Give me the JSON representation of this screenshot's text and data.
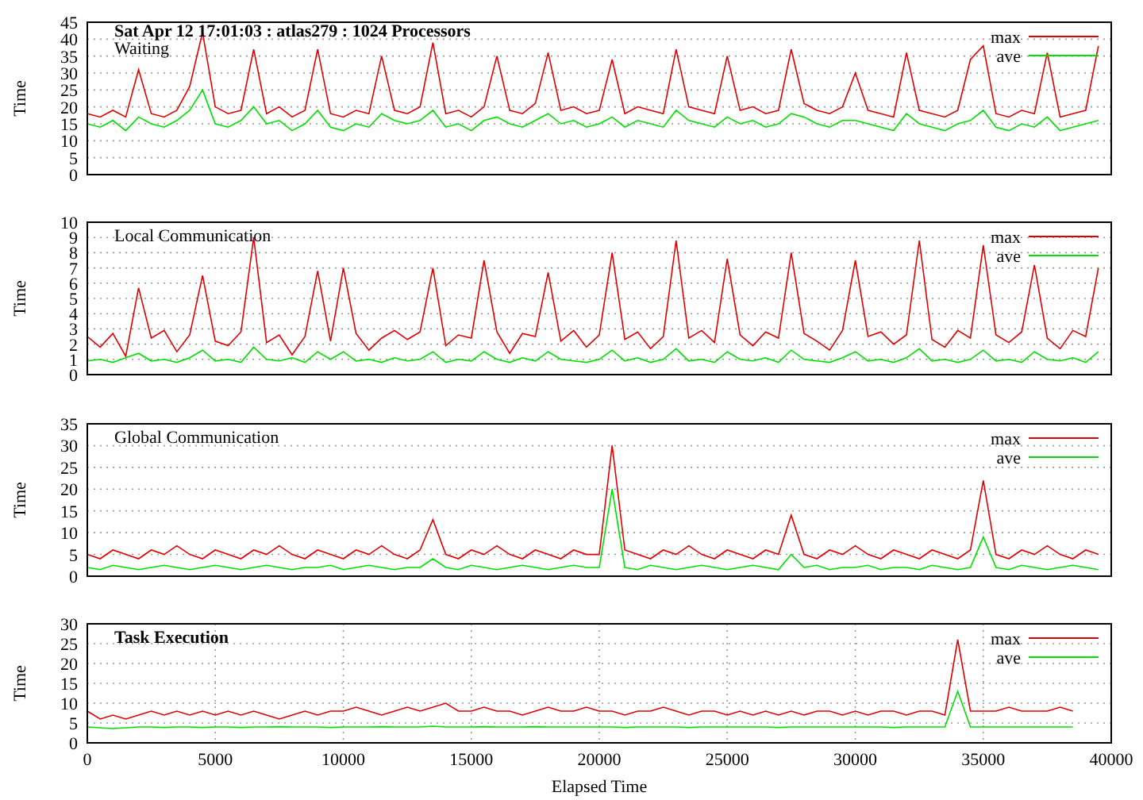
{
  "header": "Sat Apr 12 17:01:03 : atlas279 : 1024 Processors",
  "charts": [
    {
      "chart_data": {
        "type": "line",
        "title": "Waiting",
        "ylabel": "Time",
        "xlim": [
          0,
          40000
        ],
        "ylim": [
          0,
          45
        ],
        "yticks": [
          0,
          5,
          10,
          15,
          20,
          25,
          30,
          35,
          40,
          45
        ],
        "grid": "y",
        "legend": "top right",
        "x": [
          0,
          500,
          1000,
          1500,
          2000,
          2500,
          3000,
          3500,
          4000,
          4500,
          5000,
          5500,
          6000,
          6500,
          7000,
          7500,
          8000,
          8500,
          9000,
          9500,
          10000,
          10500,
          11000,
          11500,
          12000,
          12500,
          13000,
          13500,
          14000,
          14500,
          15000,
          15500,
          16000,
          16500,
          17000,
          17500,
          18000,
          18500,
          19000,
          19500,
          20000,
          20500,
          21000,
          21500,
          22000,
          22500,
          23000,
          23500,
          24000,
          24500,
          25000,
          25500,
          26000,
          26500,
          27000,
          27500,
          28000,
          28500,
          29000,
          29500,
          30000,
          30500,
          31000,
          31500,
          32000,
          32500,
          33000,
          33500,
          34000,
          34500,
          35000,
          35500,
          36000,
          36500,
          37000,
          37500,
          38000,
          38500,
          39000,
          39500
        ],
        "series": [
          {
            "name": "max",
            "color": "#e00000",
            "values": [
              18,
              17,
              19,
              17,
              31,
              18,
              17,
              19,
              26,
              42,
              20,
              18,
              19,
              37,
              18,
              20,
              17,
              19,
              37,
              18,
              17,
              19,
              18,
              35,
              19,
              18,
              20,
              39,
              18,
              19,
              17,
              20,
              35,
              19,
              18,
              21,
              36,
              19,
              20,
              18,
              19,
              34,
              18,
              20,
              19,
              18,
              37,
              20,
              19,
              18,
              35,
              19,
              20,
              18,
              19,
              37,
              21,
              19,
              18,
              20,
              30,
              19,
              18,
              17,
              36,
              19,
              18,
              17,
              19,
              34,
              38,
              18,
              17,
              19,
              18,
              36,
              17,
              18,
              19,
              38
            ]
          },
          {
            "name": "ave",
            "color": "#00e000",
            "values": [
              15,
              14,
              16,
              13,
              17,
              15,
              14,
              16,
              19,
              25,
              15,
              14,
              16,
              20,
              15,
              16,
              13,
              15,
              19,
              14,
              13,
              15,
              14,
              18,
              16,
              15,
              16,
              19,
              14,
              15,
              13,
              16,
              17,
              15,
              14,
              16,
              18,
              15,
              16,
              14,
              15,
              17,
              14,
              16,
              15,
              14,
              19,
              16,
              15,
              14,
              17,
              15,
              16,
              14,
              15,
              18,
              17,
              15,
              14,
              16,
              16,
              15,
              14,
              13,
              18,
              15,
              14,
              13,
              15,
              16,
              19,
              14,
              13,
              15,
              14,
              17,
              13,
              14,
              15,
              16
            ]
          }
        ]
      }
    },
    {
      "chart_data": {
        "type": "line",
        "title": "Local Communication",
        "ylabel": "Time",
        "xlim": [
          0,
          40000
        ],
        "ylim": [
          0,
          10
        ],
        "yticks": [
          0,
          1,
          2,
          3,
          4,
          5,
          6,
          7,
          8,
          9,
          10
        ],
        "grid": "y",
        "legend": "top right",
        "x": [
          0,
          500,
          1000,
          1500,
          2000,
          2500,
          3000,
          3500,
          4000,
          4500,
          5000,
          5500,
          6000,
          6500,
          7000,
          7500,
          8000,
          8500,
          9000,
          9500,
          10000,
          10500,
          11000,
          11500,
          12000,
          12500,
          13000,
          13500,
          14000,
          14500,
          15000,
          15500,
          16000,
          16500,
          17000,
          17500,
          18000,
          18500,
          19000,
          19500,
          20000,
          20500,
          21000,
          21500,
          22000,
          22500,
          23000,
          23500,
          24000,
          24500,
          25000,
          25500,
          26000,
          26500,
          27000,
          27500,
          28000,
          28500,
          29000,
          29500,
          30000,
          30500,
          31000,
          31500,
          32000,
          32500,
          33000,
          33500,
          34000,
          34500,
          35000,
          35500,
          36000,
          36500,
          37000,
          37500,
          38000,
          38500,
          39000,
          39500
        ],
        "series": [
          {
            "name": "max",
            "color": "#e00000",
            "values": [
              2.5,
              1.8,
              2.7,
              1.2,
              5.7,
              2.4,
              2.9,
              1.5,
              2.6,
              6.5,
              2.2,
              1.9,
              2.8,
              9,
              2.1,
              2.6,
              1.3,
              2.5,
              6.8,
              2.2,
              7,
              2.7,
              1.6,
              2.4,
              2.9,
              2.3,
              2.8,
              7,
              1.9,
              2.6,
              2.4,
              7.5,
              2.8,
              1.4,
              2.7,
              2.5,
              6.7,
              2.2,
              2.9,
              1.8,
              2.6,
              8,
              2.3,
              2.8,
              1.7,
              2.5,
              8.8,
              2.4,
              2.9,
              2.1,
              7.6,
              2.6,
              1.9,
              2.8,
              2.4,
              8,
              2.7,
              2.2,
              1.6,
              2.9,
              7.5,
              2.5,
              2.8,
              2,
              2.6,
              8.8,
              2.3,
              1.8,
              2.9,
              2.4,
              8.5,
              2.6,
              2.1,
              2.8,
              7.2,
              2.4,
              1.7,
              2.9,
              2.5,
              7
            ]
          },
          {
            "name": "ave",
            "color": "#00e000",
            "values": [
              0.9,
              1,
              0.8,
              1.1,
              1.4,
              0.9,
              1,
              0.8,
              1.1,
              1.6,
              0.9,
              1,
              0.8,
              1.8,
              1,
              0.9,
              1.1,
              0.8,
              1.5,
              1,
              1.5,
              0.9,
              1,
              0.8,
              1.1,
              0.9,
              1,
              1.5,
              0.8,
              1,
              0.9,
              1.5,
              1,
              0.8,
              1.1,
              0.9,
              1.5,
              1,
              0.9,
              0.8,
              1,
              1.6,
              0.9,
              1.1,
              0.8,
              1,
              1.7,
              0.9,
              1,
              0.8,
              1.5,
              1,
              0.9,
              1.1,
              0.8,
              1.6,
              1,
              0.9,
              0.8,
              1.1,
              1.5,
              0.9,
              1,
              0.8,
              1.1,
              1.7,
              0.9,
              1,
              0.8,
              1,
              1.6,
              0.9,
              1,
              0.8,
              1.5,
              1,
              0.9,
              1.1,
              0.8,
              1.5
            ]
          }
        ]
      }
    },
    {
      "chart_data": {
        "type": "line",
        "title": "Global Communication",
        "ylabel": "Time",
        "xlim": [
          0,
          40000
        ],
        "ylim": [
          0,
          35
        ],
        "yticks": [
          0,
          5,
          10,
          15,
          20,
          25,
          30,
          35
        ],
        "grid": "y",
        "legend": "top right",
        "x": [
          0,
          500,
          1000,
          1500,
          2000,
          2500,
          3000,
          3500,
          4000,
          4500,
          5000,
          5500,
          6000,
          6500,
          7000,
          7500,
          8000,
          8500,
          9000,
          9500,
          10000,
          10500,
          11000,
          11500,
          12000,
          12500,
          13000,
          13500,
          14000,
          14500,
          15000,
          15500,
          16000,
          16500,
          17000,
          17500,
          18000,
          18500,
          19000,
          19500,
          20000,
          20500,
          21000,
          21500,
          22000,
          22500,
          23000,
          23500,
          24000,
          24500,
          25000,
          25500,
          26000,
          26500,
          27000,
          27500,
          28000,
          28500,
          29000,
          29500,
          30000,
          30500,
          31000,
          31500,
          32000,
          32500,
          33000,
          33500,
          34000,
          34500,
          35000,
          35500,
          36000,
          36500,
          37000,
          37500,
          38000,
          38500,
          39000,
          39500
        ],
        "series": [
          {
            "name": "max",
            "color": "#e00000",
            "values": [
              5,
              4,
              6,
              5,
              4,
              6,
              5,
              7,
              5,
              4,
              6,
              5,
              4,
              6,
              5,
              7,
              5,
              4,
              6,
              5,
              4,
              6,
              5,
              7,
              5,
              4,
              6,
              13,
              5,
              4,
              6,
              5,
              7,
              5,
              4,
              6,
              5,
              4,
              6,
              5,
              5,
              30,
              6,
              5,
              4,
              6,
              5,
              7,
              5,
              4,
              6,
              5,
              4,
              6,
              5,
              14,
              5,
              4,
              6,
              5,
              7,
              5,
              4,
              6,
              5,
              4,
              6,
              5,
              4,
              6,
              22,
              5,
              4,
              6,
              5,
              7,
              5,
              4,
              6,
              5
            ]
          },
          {
            "name": "ave",
            "color": "#00e000",
            "values": [
              2,
              1.5,
              2.5,
              2,
              1.5,
              2,
              2.5,
              2,
              1.5,
              2,
              2.5,
              2,
              1.5,
              2,
              2.5,
              2,
              1.5,
              2,
              2,
              2.5,
              1.5,
              2,
              2.5,
              2,
              1.5,
              2,
              2,
              4,
              2,
              1.5,
              2.5,
              2,
              1.5,
              2,
              2.5,
              2,
              1.5,
              2,
              2.5,
              2,
              2,
              20,
              2,
              1.5,
              2.5,
              2,
              1.5,
              2,
              2.5,
              2,
              1.5,
              2,
              2.5,
              2,
              1.5,
              5,
              2,
              2.5,
              1.5,
              2,
              2,
              2.5,
              1.5,
              2,
              2,
              1.5,
              2.5,
              2,
              1.5,
              2,
              9,
              2,
              1.5,
              2.5,
              2,
              1.5,
              2,
              2.5,
              2,
              1.5
            ]
          }
        ]
      }
    },
    {
      "chart_data": {
        "type": "line",
        "title": "Task Execution",
        "xlabel": "Elapsed Time",
        "ylabel": "Time",
        "xlim": [
          0,
          40000
        ],
        "ylim": [
          0,
          30
        ],
        "yticks": [
          0,
          5,
          10,
          15,
          20,
          25,
          30
        ],
        "xticks": [
          0,
          5000,
          10000,
          15000,
          20000,
          25000,
          30000,
          35000,
          40000
        ],
        "grid": "both",
        "legend": "top right",
        "x": [
          0,
          500,
          1000,
          1500,
          2000,
          2500,
          3000,
          3500,
          4000,
          4500,
          5000,
          5500,
          6000,
          6500,
          7000,
          7500,
          8000,
          8500,
          9000,
          9500,
          10000,
          10500,
          11000,
          11500,
          12000,
          12500,
          13000,
          13500,
          14000,
          14500,
          15000,
          15500,
          16000,
          16500,
          17000,
          17500,
          18000,
          18500,
          19000,
          19500,
          20000,
          20500,
          21000,
          21500,
          22000,
          22500,
          23000,
          23500,
          24000,
          24500,
          25000,
          25500,
          26000,
          26500,
          27000,
          27500,
          28000,
          28500,
          29000,
          29500,
          30000,
          30500,
          31000,
          31500,
          32000,
          32500,
          33000,
          33500,
          34000,
          34500,
          35000,
          35500,
          36000,
          36500,
          37000,
          37500,
          38000,
          38500
        ],
        "series": [
          {
            "name": "max",
            "color": "#e00000",
            "values": [
              8,
              6,
              7,
              6,
              7,
              8,
              7,
              8,
              7,
              8,
              7,
              8,
              7,
              8,
              7,
              6,
              7,
              8,
              7,
              8,
              8,
              9,
              8,
              7,
              8,
              9,
              8,
              9,
              10,
              8,
              8,
              9,
              8,
              8,
              7,
              8,
              9,
              8,
              8,
              9,
              8,
              8,
              7,
              8,
              8,
              9,
              8,
              7,
              8,
              8,
              7,
              8,
              7,
              8,
              7,
              8,
              7,
              8,
              8,
              7,
              8,
              7,
              8,
              8,
              7,
              8,
              8,
              7,
              26,
              8,
              8,
              8,
              9,
              8,
              8,
              8,
              9,
              8
            ]
          },
          {
            "name": "ave",
            "color": "#00e000",
            "values": [
              4,
              3.8,
              3.6,
              3.8,
              4,
              4,
              3.9,
              4,
              4,
              3.9,
              4,
              4,
              3.9,
              4,
              4,
              4.1,
              4,
              4,
              4,
              3.9,
              4,
              4,
              4,
              4.1,
              4,
              4,
              4,
              4.2,
              4,
              4,
              4,
              4.1,
              4,
              4,
              4,
              4.1,
              4,
              4,
              4,
              4,
              4,
              4,
              3.9,
              4,
              4,
              4,
              4,
              3.9,
              4,
              4,
              4,
              4,
              4,
              4,
              3.9,
              4,
              4,
              4,
              4,
              4,
              4,
              4,
              4,
              3.9,
              4,
              4,
              4,
              4,
              13,
              4,
              4,
              4,
              4,
              4,
              4,
              4,
              4,
              4
            ]
          }
        ]
      }
    }
  ]
}
